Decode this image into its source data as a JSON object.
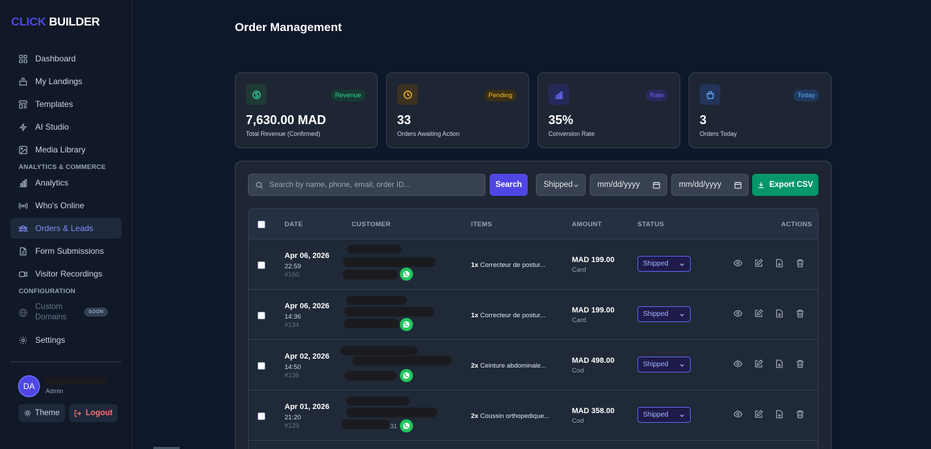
{
  "brand": {
    "part1": "CLICK",
    "part2": "BUILDER",
    "accent": "#4f46e5"
  },
  "sidebar": {
    "items": [
      {
        "label": "Dashboard",
        "icon": "grid-icon"
      },
      {
        "label": "My Landings",
        "icon": "layers-icon"
      },
      {
        "label": "Templates",
        "icon": "template-icon"
      },
      {
        "label": "AI Studio",
        "icon": "bolt-icon"
      },
      {
        "label": "Media Library",
        "icon": "image-icon"
      },
      {
        "label": "Analytics",
        "icon": "bar-chart-icon"
      },
      {
        "label": "Who's Online",
        "icon": "broadcast-icon"
      },
      {
        "label": "Orders & Leads",
        "icon": "users-icon",
        "active": true
      },
      {
        "label": "Form Submissions",
        "icon": "file-icon"
      },
      {
        "label": "Visitor Recordings",
        "icon": "video-icon"
      },
      {
        "label": "Custom Domains",
        "icon": "globe-icon",
        "badge": "SOON"
      },
      {
        "label": "Settings",
        "icon": "gear-icon"
      }
    ],
    "sections": {
      "analytics": "ANALYTICS & COMMERCE",
      "configuration": "CONFIGURATION"
    },
    "user": {
      "initials": "DA",
      "role": "Admin"
    },
    "theme_label": "Theme",
    "logout_label": "Logout"
  },
  "page_title": "Order Management",
  "stats": [
    {
      "badge": "Revenue",
      "value": "7,630.00 MAD",
      "label": "Total Revenue (Confirmed)",
      "icon": "dollar-icon",
      "color": "#34d399"
    },
    {
      "badge": "Pending",
      "value": "33",
      "label": "Orders Awaiting Action",
      "icon": "clock-icon",
      "color": "#fbbf24"
    },
    {
      "badge": "Rate",
      "value": "35%",
      "label": "Conversion Rate",
      "icon": "chart-icon",
      "color": "#6366f1"
    },
    {
      "badge": "Today",
      "value": "3",
      "label": "Orders Today",
      "icon": "bag-icon",
      "color": "#60a5fa"
    }
  ],
  "toolbar": {
    "search_placeholder": "Search by name, phone, email, order ID...",
    "search_label": "Search",
    "status_filter": "Shipped",
    "date_from": "mm/dd/yyyy",
    "date_to": "mm/dd/yyyy",
    "export_label": "Export CSV"
  },
  "table": {
    "headers": {
      "date": "DATE",
      "customer": "CUSTOMER",
      "items": "ITEMS",
      "amount": "AMOUNT",
      "status": "STATUS",
      "actions": "ACTIONS"
    },
    "rows": [
      {
        "date": "Apr 06, 2026",
        "time": "22:59",
        "id": "#150",
        "qty": "1x",
        "item": "Correcteur de postur...",
        "amount": "MAD 199.00",
        "payment": "Card",
        "status": "Shipped"
      },
      {
        "date": "Apr 06, 2026",
        "time": "14:36",
        "id": "#134",
        "qty": "1x",
        "item": "Correcteur de postur...",
        "amount": "MAD 199.00",
        "payment": "Card",
        "status": "Shipped"
      },
      {
        "date": "Apr 02, 2026",
        "time": "14:50",
        "id": "#136",
        "qty": "2x",
        "item": "Ceinture abdominale...",
        "amount": "MAD 498.00",
        "payment": "Cod",
        "status": "Shipped"
      },
      {
        "date": "Apr 01, 2026",
        "time": "21:20",
        "id": "#129",
        "qty": "2x",
        "item": "Coussin orthopedique...",
        "amount": "MAD 358.00",
        "payment": "Cod",
        "status": "Shipped",
        "phone_tail": "31"
      }
    ]
  }
}
